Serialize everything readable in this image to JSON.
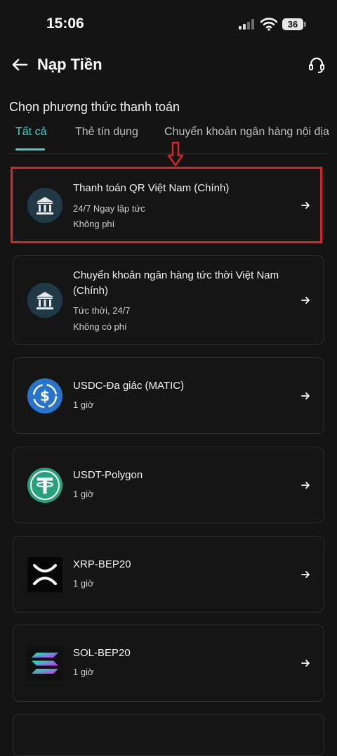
{
  "status_bar": {
    "time": "15:06",
    "battery": "36"
  },
  "header": {
    "title": "Nạp Tiền"
  },
  "section_title": "Chọn phương thức thanh toán",
  "tabs": [
    {
      "label": "Tất cả",
      "active": true
    },
    {
      "label": "Thẻ tín dụng",
      "active": false
    },
    {
      "label": "Chuyển khoản ngân hàng nội địa",
      "active": false
    }
  ],
  "methods": [
    {
      "title": "Thanh toán QR Việt Nam (Chính)",
      "line1": "24/7 Ngay lập tức",
      "line2": "Không phí",
      "icon": "bank-icon"
    },
    {
      "title": "Chuyển khoản ngân hàng tức thời Việt Nam (Chính)",
      "line1": "Tức thời, 24/7",
      "line2": "Không có phí",
      "icon": "bank-icon"
    },
    {
      "title": "USDC-Đa giác (MATIC)",
      "line1": "1 giờ",
      "icon": "usdc-icon"
    },
    {
      "title": "USDT-Polygon",
      "line1": "1 giờ",
      "icon": "usdt-icon"
    },
    {
      "title": "XRP-BEP20",
      "line1": "1 giờ",
      "icon": "xrp-icon"
    },
    {
      "title": "SOL-BEP20",
      "line1": "1 giờ",
      "icon": "sol-icon"
    }
  ],
  "colors": {
    "accent": "#3fd2c8",
    "highlight": "#d0262d",
    "background": "#141414"
  }
}
